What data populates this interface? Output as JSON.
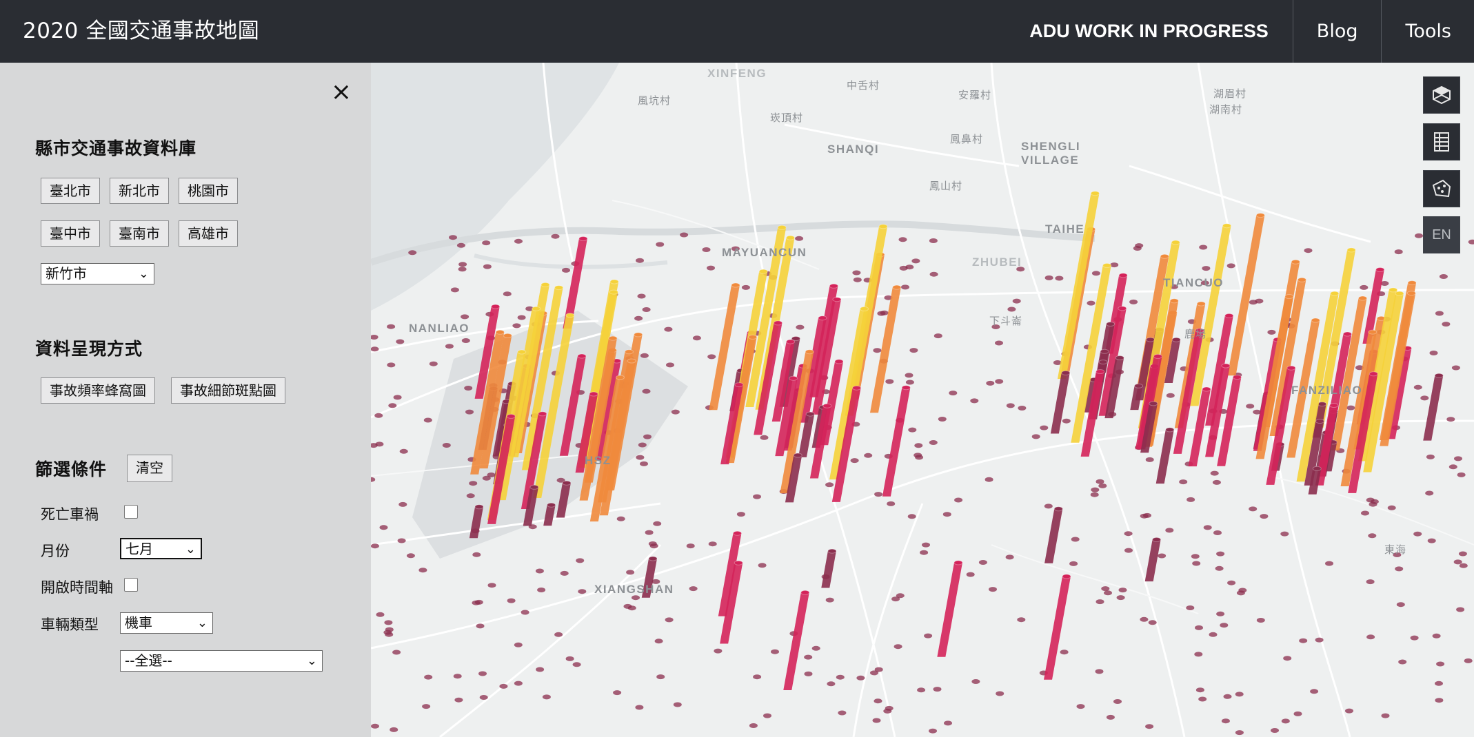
{
  "header": {
    "title": "2020 全國交通事故地圖",
    "nav": [
      "ADU WORK IN PROGRESS",
      "Blog",
      "Tools"
    ]
  },
  "sidebar": {
    "close_glyph": "×",
    "database_title": "縣市交通事故資料庫",
    "cities_row1": [
      "臺北市",
      "新北市",
      "桃園市"
    ],
    "cities_row2": [
      "臺中市",
      "臺南市",
      "高雄市"
    ],
    "city_select": "新竹市",
    "display_title": "資料呈現方式",
    "display_modes": [
      "事故頻率蜂窩圖",
      "事故細節斑點圖"
    ],
    "filter_title": "篩選條件",
    "clear_label": "清空",
    "fatal_label": "死亡車禍",
    "fatal_checked": false,
    "month_label": "月份",
    "month_value": "七月",
    "timeline_label": "開啟時間軸",
    "timeline_checked": false,
    "vehicle_label": "車輛類型",
    "vehicle_value": "機車",
    "subtype_value": "--全選--"
  },
  "map": {
    "labels": [
      "XINFENG",
      "風坑村",
      "中舌村",
      "安羅村",
      "湖眉村",
      "湖南村",
      "崁頂村",
      "SHANQI",
      "鳳鼻村",
      "SHENGLI VILLAGE",
      "鳳山村",
      "TAIHE",
      "MAYUANCUN",
      "ZHUBEI",
      "TIANCUO",
      "NANLIAO",
      "下斗崙",
      "鹿場",
      "FANZILIAO",
      "HSZ",
      "XIANGSHAN",
      "東海"
    ],
    "colors": {
      "low": "#8b2e4e",
      "mid": "#d4235a",
      "high": "#f08a3c",
      "max": "#f5d23a"
    }
  },
  "controls": {
    "icons": [
      "3d-view-icon",
      "data-table-icon",
      "map-polygon-icon"
    ],
    "lang_label": "EN"
  }
}
